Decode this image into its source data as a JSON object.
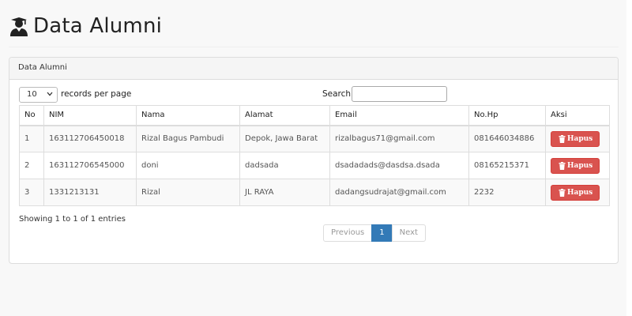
{
  "header": {
    "title": "Data Alumni",
    "icon": "graduate-icon"
  },
  "panel": {
    "heading": "Data Alumni",
    "length_value": "10",
    "length_label": "records per page",
    "search_label": "Search:",
    "search_value": ""
  },
  "table": {
    "columns": [
      "No",
      "NIM",
      "Nama",
      "Alamat",
      "Email",
      "No.Hp",
      "Aksi"
    ],
    "rows": [
      {
        "no": "1",
        "nim": "163112706450018",
        "nama": "Rizal Bagus Pambudi",
        "alamat": "Depok, Jawa Barat",
        "email": "rizalbagus71@gmail.com",
        "nohp": "081646034886",
        "aksi": "Hapus"
      },
      {
        "no": "2",
        "nim": "163112706545000",
        "nama": "doni",
        "alamat": "dadsada",
        "email": "dsadadads@dasdsa.dsada",
        "nohp": "08165215371",
        "aksi": "Hapus"
      },
      {
        "no": "3",
        "nim": "1331213131",
        "nama": "Rizal",
        "alamat": "JL RAYA",
        "email": "dadangsudrajat@gmail.com",
        "nohp": "2232",
        "aksi": "Hapus"
      }
    ]
  },
  "info": "Showing 1 to 1 of 1 entries",
  "pagination": {
    "previous": "Previous",
    "current": "1",
    "next": "Next"
  },
  "colors": {
    "danger": "#d9534f",
    "primary": "#337ab7"
  }
}
